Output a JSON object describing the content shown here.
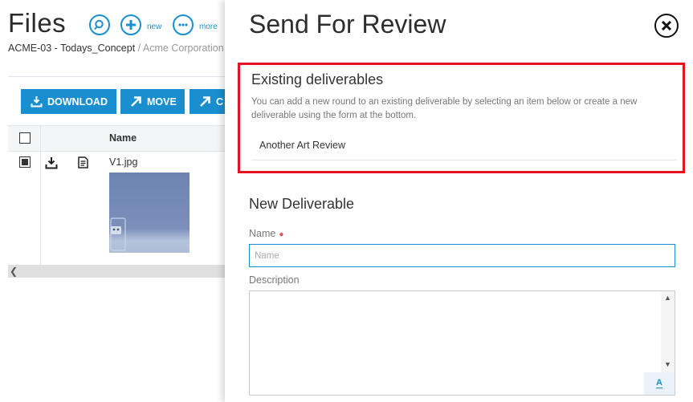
{
  "files": {
    "title": "Files",
    "toolbar_circles": [
      {
        "icon": "search-icon",
        "label": ""
      },
      {
        "icon": "plus-icon",
        "label": "new"
      },
      {
        "icon": "more-icon",
        "label": "more"
      }
    ],
    "breadcrumb": {
      "project": "ACME-03 - Todays_Concept",
      "separator": " / ",
      "org": "Acme Corporation"
    },
    "actions": [
      {
        "label": "DOWNLOAD",
        "icon": "download-icon"
      },
      {
        "label": "MOVE",
        "icon": "arrow-up-right-icon"
      },
      {
        "label": "C",
        "icon": "arrow-up-right-icon"
      }
    ],
    "table": {
      "name_header": "Name",
      "rows": [
        {
          "filename": "V1.jpg",
          "checked": true
        }
      ]
    }
  },
  "drawer": {
    "title": "Send For Review",
    "existing": {
      "heading": "Existing deliverables",
      "description": "You can add a new round to an existing deliverable by selecting an item below or create a new deliverable using the form at the bottom.",
      "items": [
        "Another Art Review"
      ]
    },
    "new_deliverable": {
      "heading": "New Deliverable",
      "name_label": "Name",
      "name_required_mark": "●",
      "name_placeholder": "Name",
      "name_value": "",
      "description_label": "Description",
      "description_value": "",
      "format_button": "A"
    }
  },
  "colors": {
    "accent": "#1a8fd0",
    "highlight_border": "#e81123",
    "required": "#d9534f"
  }
}
